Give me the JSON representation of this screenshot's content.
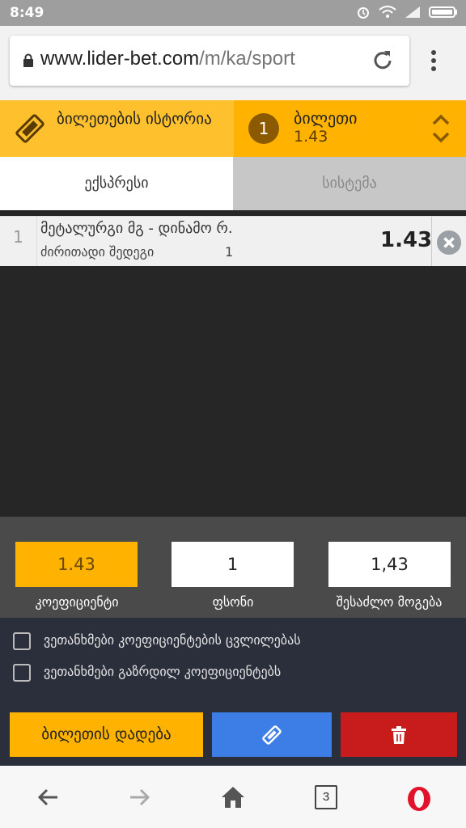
{
  "status_bar": {
    "time": "8:49"
  },
  "browser": {
    "url_domain": "www.lider-bet.com",
    "url_path": "/m/ka/sport",
    "open_tabs": "3"
  },
  "ticket_header": {
    "history_label": "ბილეთების ისტორია",
    "ticket_count": "1",
    "ticket_title": "ბილეთი",
    "ticket_odds": "1.43"
  },
  "tabs": [
    {
      "label": "ექსპრესი",
      "active": true
    },
    {
      "label": "სისტემა",
      "active": false
    }
  ],
  "bets": [
    {
      "number": "1",
      "match": "მეტალურგი მგ - დინამო რ.",
      "market": "ძირითადი შედეგი",
      "pick": "1",
      "odds": "1.43"
    }
  ],
  "summary": {
    "odds_value": "1.43",
    "odds_label": "კოეფიციენტი",
    "stake_value": "1",
    "stake_label": "ფსონი",
    "win_value": "1,43",
    "win_label": "შესაძლო მოგება"
  },
  "agreements": [
    {
      "label": "ვეთანხმები კოეფიციენტების ცვლილებას",
      "checked": false
    },
    {
      "label": "ვეთანხმები გაზრდილ კოეფიციენტებს",
      "checked": false
    }
  ],
  "actions": {
    "place_label": "ბილეთის დადება"
  },
  "icons": {
    "history": "ticket-icon",
    "toggle": "chevron-up-down-icon",
    "remove": "close-circle-icon",
    "edit": "ticket-icon",
    "delete": "trash-icon"
  },
  "colors": {
    "accent_yellow": "#ffb300",
    "history_yellow": "#fec12d",
    "edit_blue": "#3d7de6",
    "delete_red": "#c81b1b",
    "panel_dark": "#2b2e3b"
  }
}
